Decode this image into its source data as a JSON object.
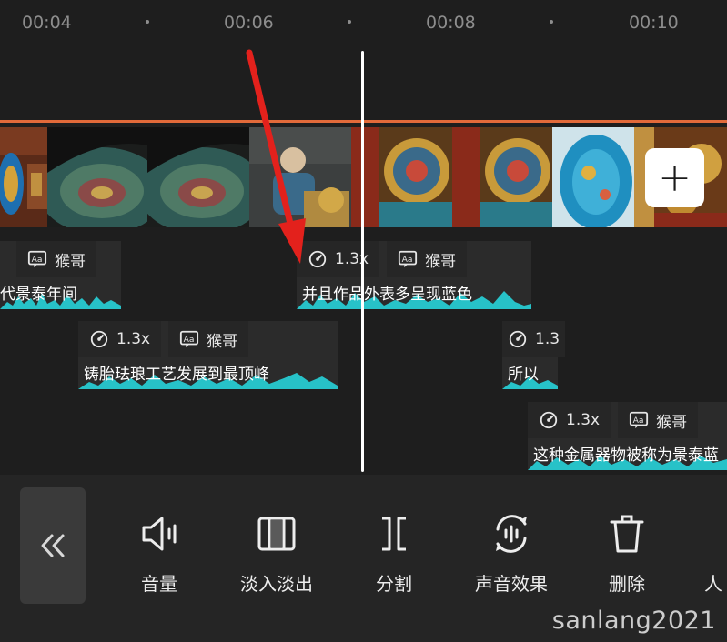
{
  "ruler": {
    "ticks": [
      "00:04",
      "00:06",
      "00:08",
      "00:10"
    ]
  },
  "clips": [
    {
      "speed": "",
      "voice": "猴哥",
      "caption": "代景泰年间"
    },
    {
      "speed": "1.3x",
      "voice": "猴哥",
      "caption": "并且作品外表多呈现蓝色"
    },
    {
      "speed": "1.3x",
      "voice": "猴哥",
      "caption": "铸胎珐琅工艺发展到最顶峰"
    },
    {
      "speed": "1.3",
      "voice": "",
      "caption": "所以"
    },
    {
      "speed": "1.3x",
      "voice": "猴哥",
      "caption": "这种金属器物被称为景泰蓝"
    }
  ],
  "toolbar": {
    "tools": [
      {
        "label": "音量",
        "icon": "volume-icon"
      },
      {
        "label": "淡入淡出",
        "icon": "fade-icon"
      },
      {
        "label": "分割",
        "icon": "split-icon"
      },
      {
        "label": "声音效果",
        "icon": "sound-effect-icon"
      },
      {
        "label": "删除",
        "icon": "delete-icon"
      },
      {
        "label": "人",
        "icon": "more-icon"
      }
    ]
  },
  "watermark": "sanlang2021",
  "colors": {
    "accent_line": "#e26a3a",
    "waveform": "#27c2c8",
    "playhead": "#ffffff",
    "annotation_arrow": "#e3211c"
  }
}
